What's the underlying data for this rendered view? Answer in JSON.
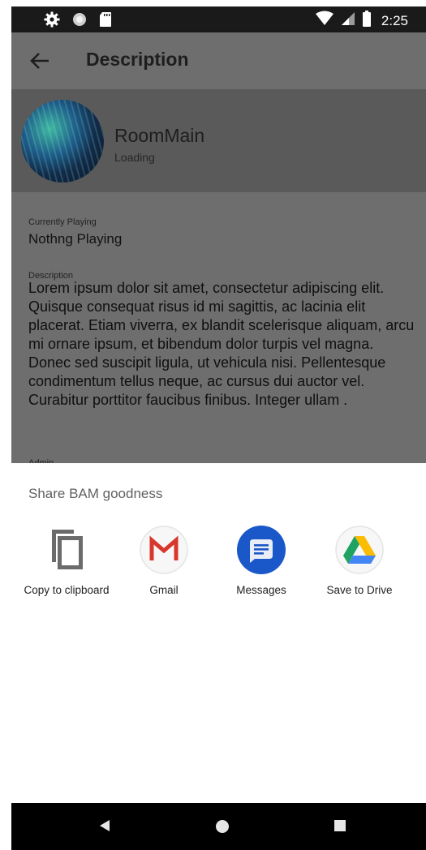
{
  "status_bar": {
    "time": "2:25",
    "icons": [
      "gear-icon",
      "sync-circle-icon",
      "sd-card-icon",
      "wifi-icon",
      "cell-signal-icon",
      "battery-icon"
    ]
  },
  "app_bar": {
    "title": "Description",
    "back_icon": "arrow-left-icon"
  },
  "room": {
    "name": "RoomMain",
    "status": "Loading"
  },
  "currently_playing": {
    "label": "Currently Playing",
    "value": "Nothng Playing"
  },
  "description": {
    "label": "Description",
    "text": "Lorem ipsum dolor sit amet, consectetur adipiscing elit. Quisque consequat risus id mi sagittis, ac lacinia elit placerat. Etiam viverra, ex blandit scelerisque aliquam, arcu mi ornare ipsum, et bibendum dolor turpis vel magna. Donec sed suscipit ligula, ut vehicula nisi. Pellentesque condimentum tellus neque, ac cursus dui auctor vel. Curabitur porttitor faucibus finibus. Integer ullam ."
  },
  "admin": {
    "label": "Admin"
  },
  "share_sheet": {
    "title": "Share BAM goodness",
    "targets": [
      {
        "label": "Copy to clipboard",
        "icon": "copy-icon"
      },
      {
        "label": "Gmail",
        "icon": "gmail-icon"
      },
      {
        "label": "Messages",
        "icon": "messages-icon"
      },
      {
        "label": "Save to Drive",
        "icon": "drive-icon"
      }
    ]
  },
  "nav_bar": {
    "icons": [
      "nav-back-icon",
      "nav-home-icon",
      "nav-recent-icon"
    ]
  },
  "colors": {
    "status_bar": "#1a1a1a",
    "app_bar_dimmed": "#6e6e6e",
    "header_dimmed": "#5a5a5a",
    "messages_blue": "#1a57c9",
    "gmail_red": "#d8372c",
    "drive_green": "#1ea362",
    "drive_yellow": "#fbbc04",
    "drive_blue": "#4285f4"
  }
}
